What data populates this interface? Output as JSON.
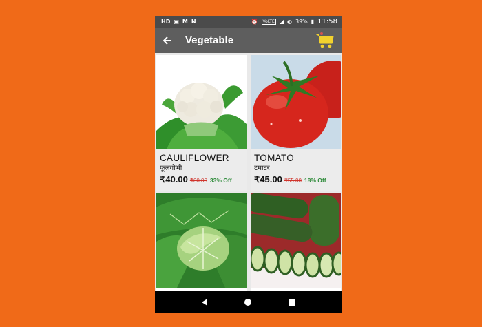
{
  "status_bar": {
    "left_icons": [
      "hd-icon",
      "image-icon",
      "m-icon",
      "n-icon"
    ],
    "left_labels": [
      "HD",
      "▣",
      "M",
      "N"
    ],
    "volte": "VoLTE",
    "battery": "39%",
    "time": "11:58"
  },
  "app_bar": {
    "title": "Vegetable"
  },
  "products": [
    {
      "name": "CAULIFLOWER",
      "hindi_name": "फूलगोभी",
      "price": "₹40.00",
      "mrp": "₹60.00",
      "discount": "33% Off",
      "image": "cauliflower-image"
    },
    {
      "name": "TOMATO",
      "hindi_name": "टमाटर",
      "price": "₹45.00",
      "mrp": "₹55.00",
      "discount": "18% Off",
      "image": "tomato-image"
    },
    {
      "image": "cabbage-image"
    },
    {
      "image": "cucumber-image"
    }
  ],
  "colors": {
    "background": "#F06A18",
    "app_bar": "#5e5e5e",
    "status_bar": "#4b4b4b",
    "price_strike": "#d0342c",
    "discount": "#2e8b3a",
    "cart": "#f2d22e"
  }
}
